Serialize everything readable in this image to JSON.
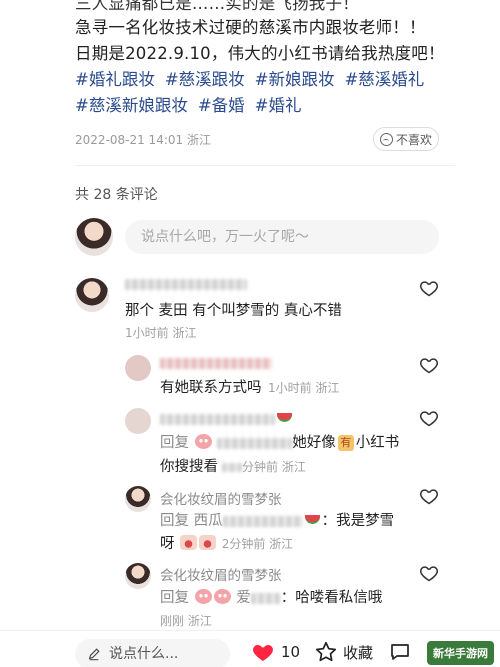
{
  "post": {
    "cut_line": "三人显痛都已是……实的是飞扬我子！",
    "line1": "急寻一名化妆技术过硬的慈溪市内跟妆老师！！",
    "line2": "日期是2022.9.10，伟大的小红书请给我热度吧！",
    "tags_row1": [
      "#婚礼跟妆",
      "#慈溪跟妆",
      "#新娘跟妆",
      "#慈溪婚礼"
    ],
    "tags_row2": [
      "#慈溪新娘跟妆",
      "#备婚",
      "#婚礼"
    ],
    "date": "2022-08-21 14:01",
    "location": "浙江",
    "dislike_label": "不喜欢"
  },
  "comments_header": "共 28 条评论",
  "reply_placeholder": "说点什么吧，万一火了呢～",
  "comments": [
    {
      "text": "那个 麦田 有个叫梦雪的 真心不错",
      "time": "1小时前 浙江"
    },
    {
      "text": "有她联系方式吗",
      "time": "1小时前 浙江"
    },
    {
      "reply_prefix": "回复",
      "text_tail": "她好像",
      "badge": "有",
      "text_end": "小红书",
      "line2": "你搜搜看",
      "time_tail": "分钟前 浙江"
    },
    {
      "name": "会化妆纹眉的雪梦张",
      "reply_prefix": "回复",
      "reply_name": "西瓜",
      "text": "：我是梦雪",
      "line2": "呀",
      "time": "2分钟前 浙江"
    },
    {
      "name": "会化妆纹眉的雪梦张",
      "reply_prefix": "回复",
      "reply_name": "爱",
      "text": "：哈喽看私信哦",
      "time": "刚刚 浙江"
    }
  ],
  "bottom": {
    "input_placeholder": "说点什么...",
    "like_count": "10",
    "collect_label": "收藏",
    "watermark": "新华手游网"
  },
  "colors": {
    "tag": "#2a4b8d",
    "like": "#ff2442"
  }
}
